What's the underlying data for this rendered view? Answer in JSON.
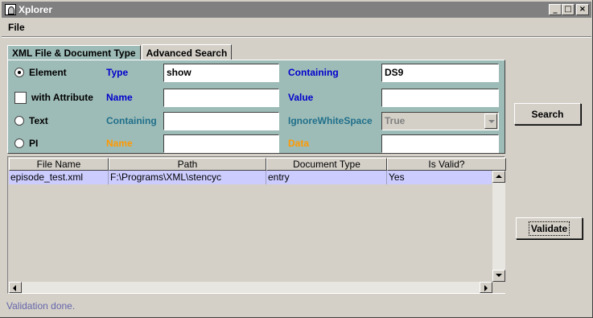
{
  "window": {
    "title": "Xplorer"
  },
  "title_buttons": {
    "minimize": "_",
    "maximize": "□",
    "close": "×"
  },
  "menu": {
    "file": "File"
  },
  "tabs": [
    {
      "label": "XML File & Document Type"
    },
    {
      "label": "Advanced Search"
    }
  ],
  "search": {
    "element": {
      "option": "Element",
      "selected": true,
      "type_label": "Type",
      "type_value": "show",
      "containing_label": "Containing",
      "containing_value": "DS9"
    },
    "attribute": {
      "option": "with Attribute",
      "checked": false,
      "name_label": "Name",
      "name_value": "",
      "value_label": "Value",
      "value_value": ""
    },
    "text": {
      "option": "Text",
      "selected": false,
      "containing_label": "Containing",
      "containing_value": "",
      "ignore_ws_label": "IgnoreWhiteSpace",
      "ignore_ws_value": "True"
    },
    "pi": {
      "option": "PI",
      "selected": false,
      "name_label": "Name",
      "name_value": "",
      "data_label": "Data",
      "data_value": ""
    }
  },
  "colors": {
    "panel": "#9ebcb7",
    "label_blue": "#0000cc",
    "label_teal": "#1f6f8b",
    "label_orange": "#ff9900",
    "selected_row": "#ccccff"
  },
  "buttons": {
    "search": "Search",
    "validate": "Validate"
  },
  "table": {
    "columns": [
      "File Name",
      "Path",
      "Document Type",
      "Is Valid?"
    ],
    "rows": [
      [
        "episode_test.xml",
        "F:\\Programs\\XML\\stencyc",
        "entry",
        "Yes"
      ]
    ]
  },
  "status": "Validation done."
}
